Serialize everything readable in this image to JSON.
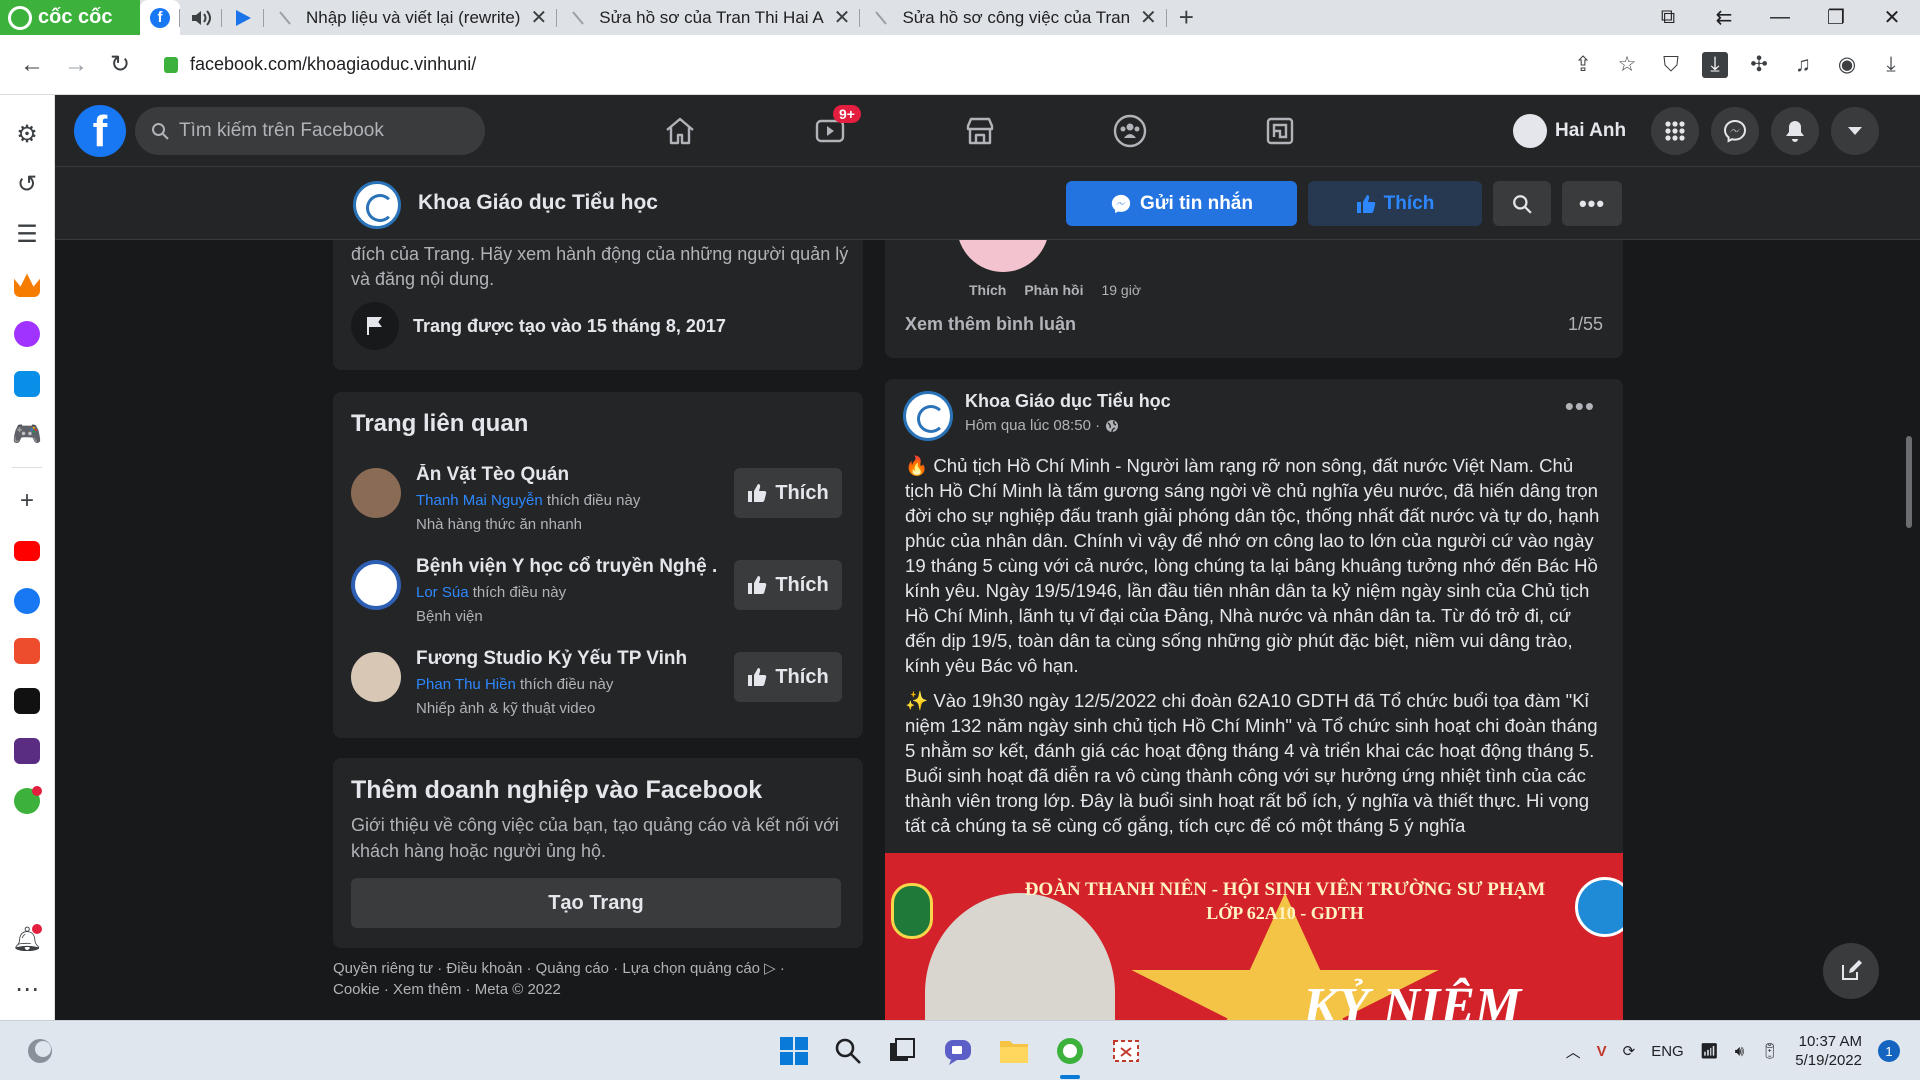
{
  "browser": {
    "brand": "cốc cốc",
    "tabs": [
      {
        "title": "Nhập liệu và viết lại (rewrite)"
      },
      {
        "title": "Sửa hồ sơ của Tran Thi Hai A"
      },
      {
        "title": "Sửa hồ sơ công việc của Tran"
      }
    ],
    "url": "facebook.com/khoagiaoduc.vinhuni/"
  },
  "fb_header": {
    "search_placeholder": "Tìm kiếm trên Facebook",
    "video_badge": "9+",
    "user_name": "Hai Anh"
  },
  "page_header": {
    "name": "Khoa Giáo dục Tiểu học",
    "message_label": "Gửi tin nhắn",
    "like_label": "Thích"
  },
  "about": {
    "text": "đích của Trang. Hãy xem hành động của những người quản lý và đăng nội dung.",
    "created": "Trang được tạo vào 15 tháng 8, 2017"
  },
  "related": {
    "title": "Trang liên quan",
    "like_label": "Thích",
    "items": [
      {
        "name": "Ăn Vặt Tèo Quán",
        "liker": "Thanh Mai Nguyễn",
        "liker_suffix": "thích điều này",
        "category": "Nhà hàng thức ăn nhanh"
      },
      {
        "name": "Bệnh viện Y học cổ truyền Nghệ ...",
        "liker": "Lor Súa",
        "liker_suffix": "thích điều này",
        "category": "Bệnh viện"
      },
      {
        "name": "Fương Studio Kỷ Yếu TP Vinh",
        "liker": "Phan Thu Hiền",
        "liker_suffix": "thích điều này",
        "category": "Nhiếp ảnh & kỹ thuật video"
      }
    ]
  },
  "business": {
    "title": "Thêm doanh nghiệp vào Facebook",
    "desc": "Giới thiệu về công việc của bạn, tạo quảng cáo và kết nối với khách hàng hoặc người ủng hộ.",
    "button": "Tạo Trang"
  },
  "footer": {
    "line1": "Quyền riêng tư · Điều khoản · Quảng cáo · Lựa chọn quảng cáo ▷ ·",
    "line2": "Cookie · Xem thêm · Meta © 2022"
  },
  "comment": {
    "like": "Thích",
    "reply": "Phản hồi",
    "time": "19 giờ",
    "see_more": "Xem thêm bình luận",
    "pager": "1/55"
  },
  "post": {
    "author": "Khoa Giáo dục Tiểu học",
    "time": "Hôm qua lúc 08:50 ·",
    "paragraph1": "🔥 Chủ tịch Hồ Chí Minh - Người làm rạng rỡ non sông, đất nước Việt Nam. Chủ tịch Hồ Chí Minh là tấm gương sáng ngời về chủ nghĩa yêu nước, đã hiến dâng trọn đời cho sự nghiệp đấu tranh giải phóng dân tộc, thống nhất đất nước và tự do, hạnh phúc của nhân dân. Chính vì vậy để nhớ ơn công lao to lớn của người cứ vào ngày 19 tháng 5 cùng với cả nước, lòng chúng ta lại bâng khuâng tưởng nhớ đến Bác Hồ kính yêu. Ngày 19/5/1946, lần đầu tiên nhân dân ta kỷ niệm ngày sinh của Chủ tịch Hồ Chí Minh, lãnh tụ vĩ đại của Đảng, Nhà nước và nhân dân ta. Từ đó trở đi, cứ đến dịp 19/5, toàn dân ta cùng sống những giờ phút đặc biệt, niềm vui dâng trào, kính yêu Bác vô hạn.",
    "paragraph2": "✨ Vào 19h30 ngày 12/5/2022 chi đoàn 62A10 GDTH đã Tổ chức buổi tọa đàm \"Kỉ niệm 132 năm ngày sinh chủ tịch Hồ Chí Minh\" và Tổ chức sinh hoạt chi đoàn tháng 5 nhằm sơ kết, đánh giá các hoạt động tháng 4 và triển khai các hoạt động tháng 5. Buổi sinh hoạt đã diễn ra vô cùng thành công với sự hưởng ứng nhiệt tình của các thành viên trong lớp. Đây là buổi sinh hoạt rất bổ ích, ý nghĩa và thiết thực. Hi vọng tất cả chúng ta sẽ cùng cố gắng, tích cực để có một tháng 5 ý nghĩa",
    "image_line1": "ĐOÀN THANH NIÊN - HỘI SINH VIÊN TRƯỜNG SƯ PHẠM",
    "image_line2": "LỚP 62A10 - GDTH",
    "image_title": "KỶ NIỆM"
  },
  "taskbar": {
    "lang": "ENG",
    "time": "10:37 AM",
    "date": "5/19/2022",
    "notifications": "1"
  }
}
